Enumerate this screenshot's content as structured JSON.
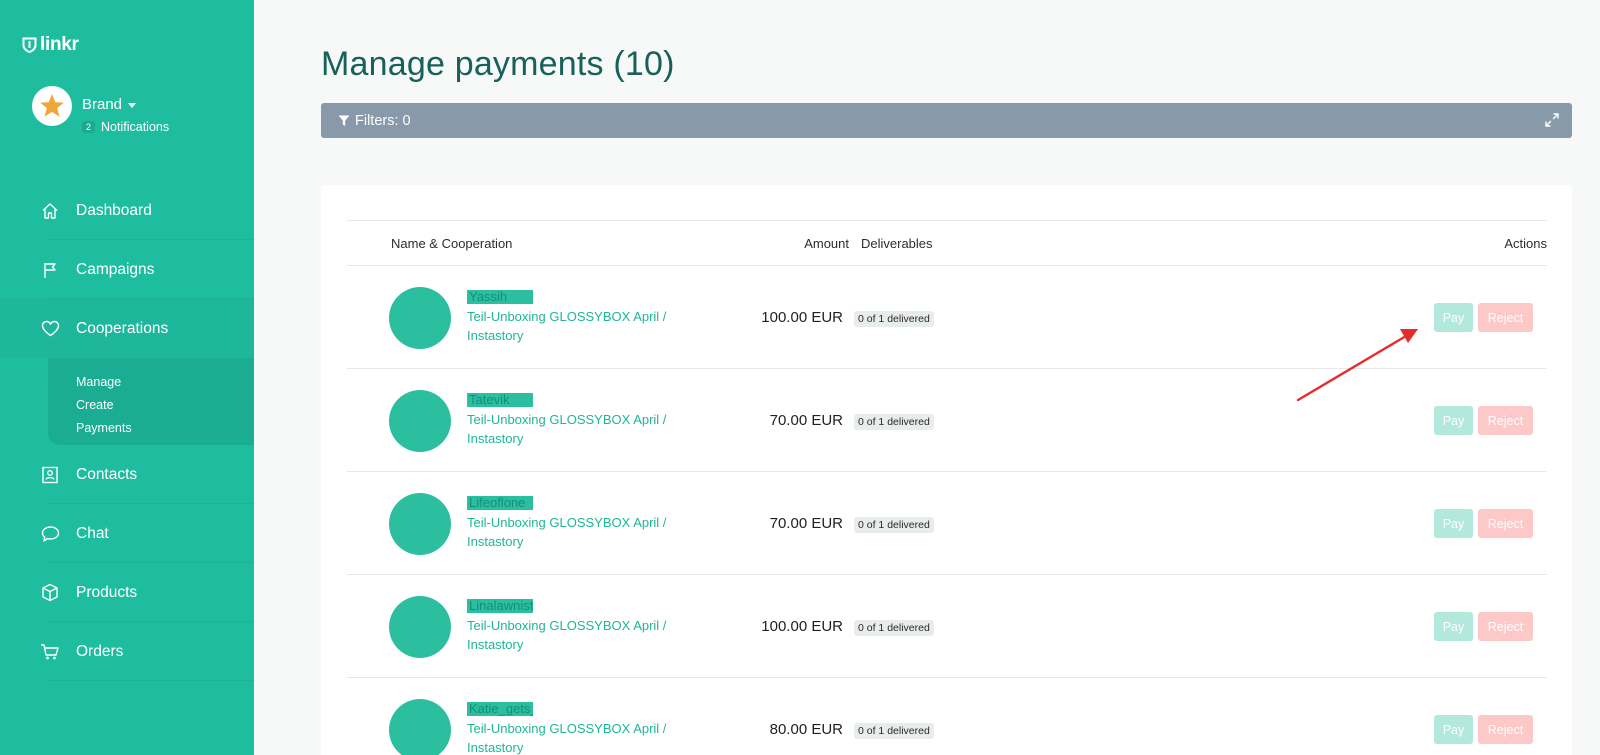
{
  "app": {
    "logo_text": "linkr"
  },
  "profile": {
    "name": "Brand",
    "notification_count": "2",
    "notifications_label": "Notifications"
  },
  "nav": {
    "dashboard": "Dashboard",
    "campaigns": "Campaigns",
    "cooperations": "Cooperations",
    "sub": {
      "manage": "Manage",
      "create": "Create",
      "payments": "Payments"
    },
    "contacts": "Contacts",
    "chat": "Chat",
    "products": "Products",
    "orders": "Orders"
  },
  "page": {
    "title": "Manage payments (10)"
  },
  "filters": {
    "label": "Filters: 0"
  },
  "table": {
    "headers": {
      "name": "Name & Cooperation",
      "amount": "Amount",
      "deliverables": "Deliverables",
      "actions": "Actions"
    },
    "pay_label": "Pay",
    "reject_label": "Reject",
    "rows": [
      {
        "username": "Yassih",
        "campaign": "Teil-Unboxing GLOSSYBOX April / Instastory",
        "amount": "100.00 EUR",
        "deliverables": "0 of 1 delivered"
      },
      {
        "username": "Tatevik",
        "campaign": "Teil-Unboxing GLOSSYBOX April / Instastory",
        "amount": "70.00 EUR",
        "deliverables": "0 of 1 delivered"
      },
      {
        "username": "Lifeoflone",
        "campaign": "Teil-Unboxing GLOSSYBOX April / Instastory",
        "amount": "70.00 EUR",
        "deliverables": "0 of 1 delivered"
      },
      {
        "username": "Linalawnista",
        "campaign": "Teil-Unboxing GLOSSYBOX April / Instastory",
        "amount": "100.00 EUR",
        "deliverables": "0 of 1 delivered"
      },
      {
        "username": "Katie_gets_fit",
        "campaign": "Teil-Unboxing GLOSSYBOX April / Instastory",
        "amount": "80.00 EUR",
        "deliverables": "0 of 1 delivered"
      }
    ]
  },
  "colors": {
    "sidebar": "#1fbda0",
    "accent_text": "#1fb696",
    "title": "#17615a",
    "filter_bar": "#8899aa",
    "pay_button": "#b3e8dd",
    "reject_button": "#fdc8c8",
    "annotation_arrow": "#e52b2b"
  },
  "icons": [
    "logo-shield-icon",
    "star-icon",
    "home-icon",
    "flag-icon",
    "heart-icon",
    "contact-card-icon",
    "chat-bubble-icon",
    "box-icon",
    "cart-icon",
    "filter-icon",
    "expand-icon"
  ]
}
